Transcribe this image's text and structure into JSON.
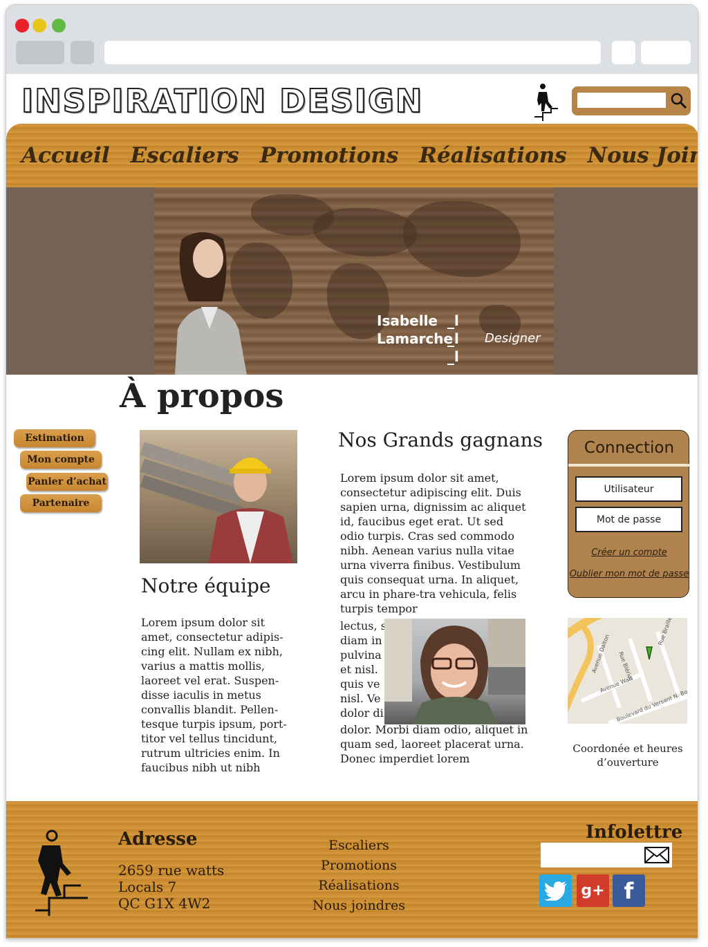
{
  "header": {
    "logo_text": "INSPIRATION DESIGN"
  },
  "nav": {
    "items": [
      "Accueil",
      "Escaliers",
      "Promotions",
      "Réalisations",
      "Nous Joindre"
    ]
  },
  "hero": {
    "name_line1": "Isabelle",
    "name_line2": "Lamarche",
    "role": "Designer",
    "marks": "_l\n_l\n_l"
  },
  "page": {
    "title": "À propos"
  },
  "sidebar": {
    "items": [
      "Estimation",
      "Mon compte",
      "Panier d’achat",
      "Partenaire"
    ]
  },
  "team": {
    "title": "Notre équipe",
    "text": "Lorem ipsum dolor sit amet, consectetur adipis-cing elit. Nullam ex nibh, varius a mattis mollis, laoreet vel erat. Suspen-disse iaculis in metus convallis blandit. Pellen-tesque turpis ipsum, port-titor vel tellus tincidunt, rutrum ultricies enim. In faucibus nibh ut nibh"
  },
  "winners": {
    "title": "Nos Grands gagnans",
    "text_top": "Lorem ipsum dolor sit amet, consectetur adipiscing elit. Duis sapien urna, dignissim ac aliquet id, faucibus eget erat. Ut sed odio turpis. Cras sed commodo nibh. Aenean varius nulla vitae urna viverra finibus. Vestibulum quis consequat urna. In aliquet, arcu in phare-tra vehicula, felis turpis tempor",
    "text_wrap": [
      "lectus, s",
      "diam in",
      "pulvina",
      "et nisl.",
      "quis ve",
      "nisl. Ve",
      "dolor di"
    ],
    "text_bottom": "dolor. Morbi diam odio, aliquet in quam sed, laoreet placerat urna. Donec imperdiet lorem"
  },
  "login": {
    "title": "Connection",
    "username": "Utilisateur",
    "password": "Mot de passe",
    "create_account": "Créer un compte",
    "forgot_password": "Oublier mon mot de passe"
  },
  "map": {
    "caption": "Coordonée et heures d’ouverture",
    "street_labels": [
      "Rue Braille",
      "Rue Blériot",
      "Avenue Dalton",
      "Avenue Watt",
      "Boulevard du Versant N. Boul."
    ]
  },
  "footer": {
    "address_title": "Adresse",
    "address_lines": [
      "2659 rue watts",
      "Locals 7",
      "QC G1X 4W2"
    ],
    "links": [
      "Escaliers",
      "Promotions",
      "Réalisations",
      "Nous joindres"
    ],
    "newsletter_title": "Infolettre",
    "social": [
      "twitter-icon",
      "google-plus-icon",
      "facebook-icon"
    ]
  },
  "colors": {
    "wood": "#c98a2d",
    "hero_bg": "#746354",
    "login_bg": "#b0834f",
    "text_dark": "#2a1c0a"
  }
}
